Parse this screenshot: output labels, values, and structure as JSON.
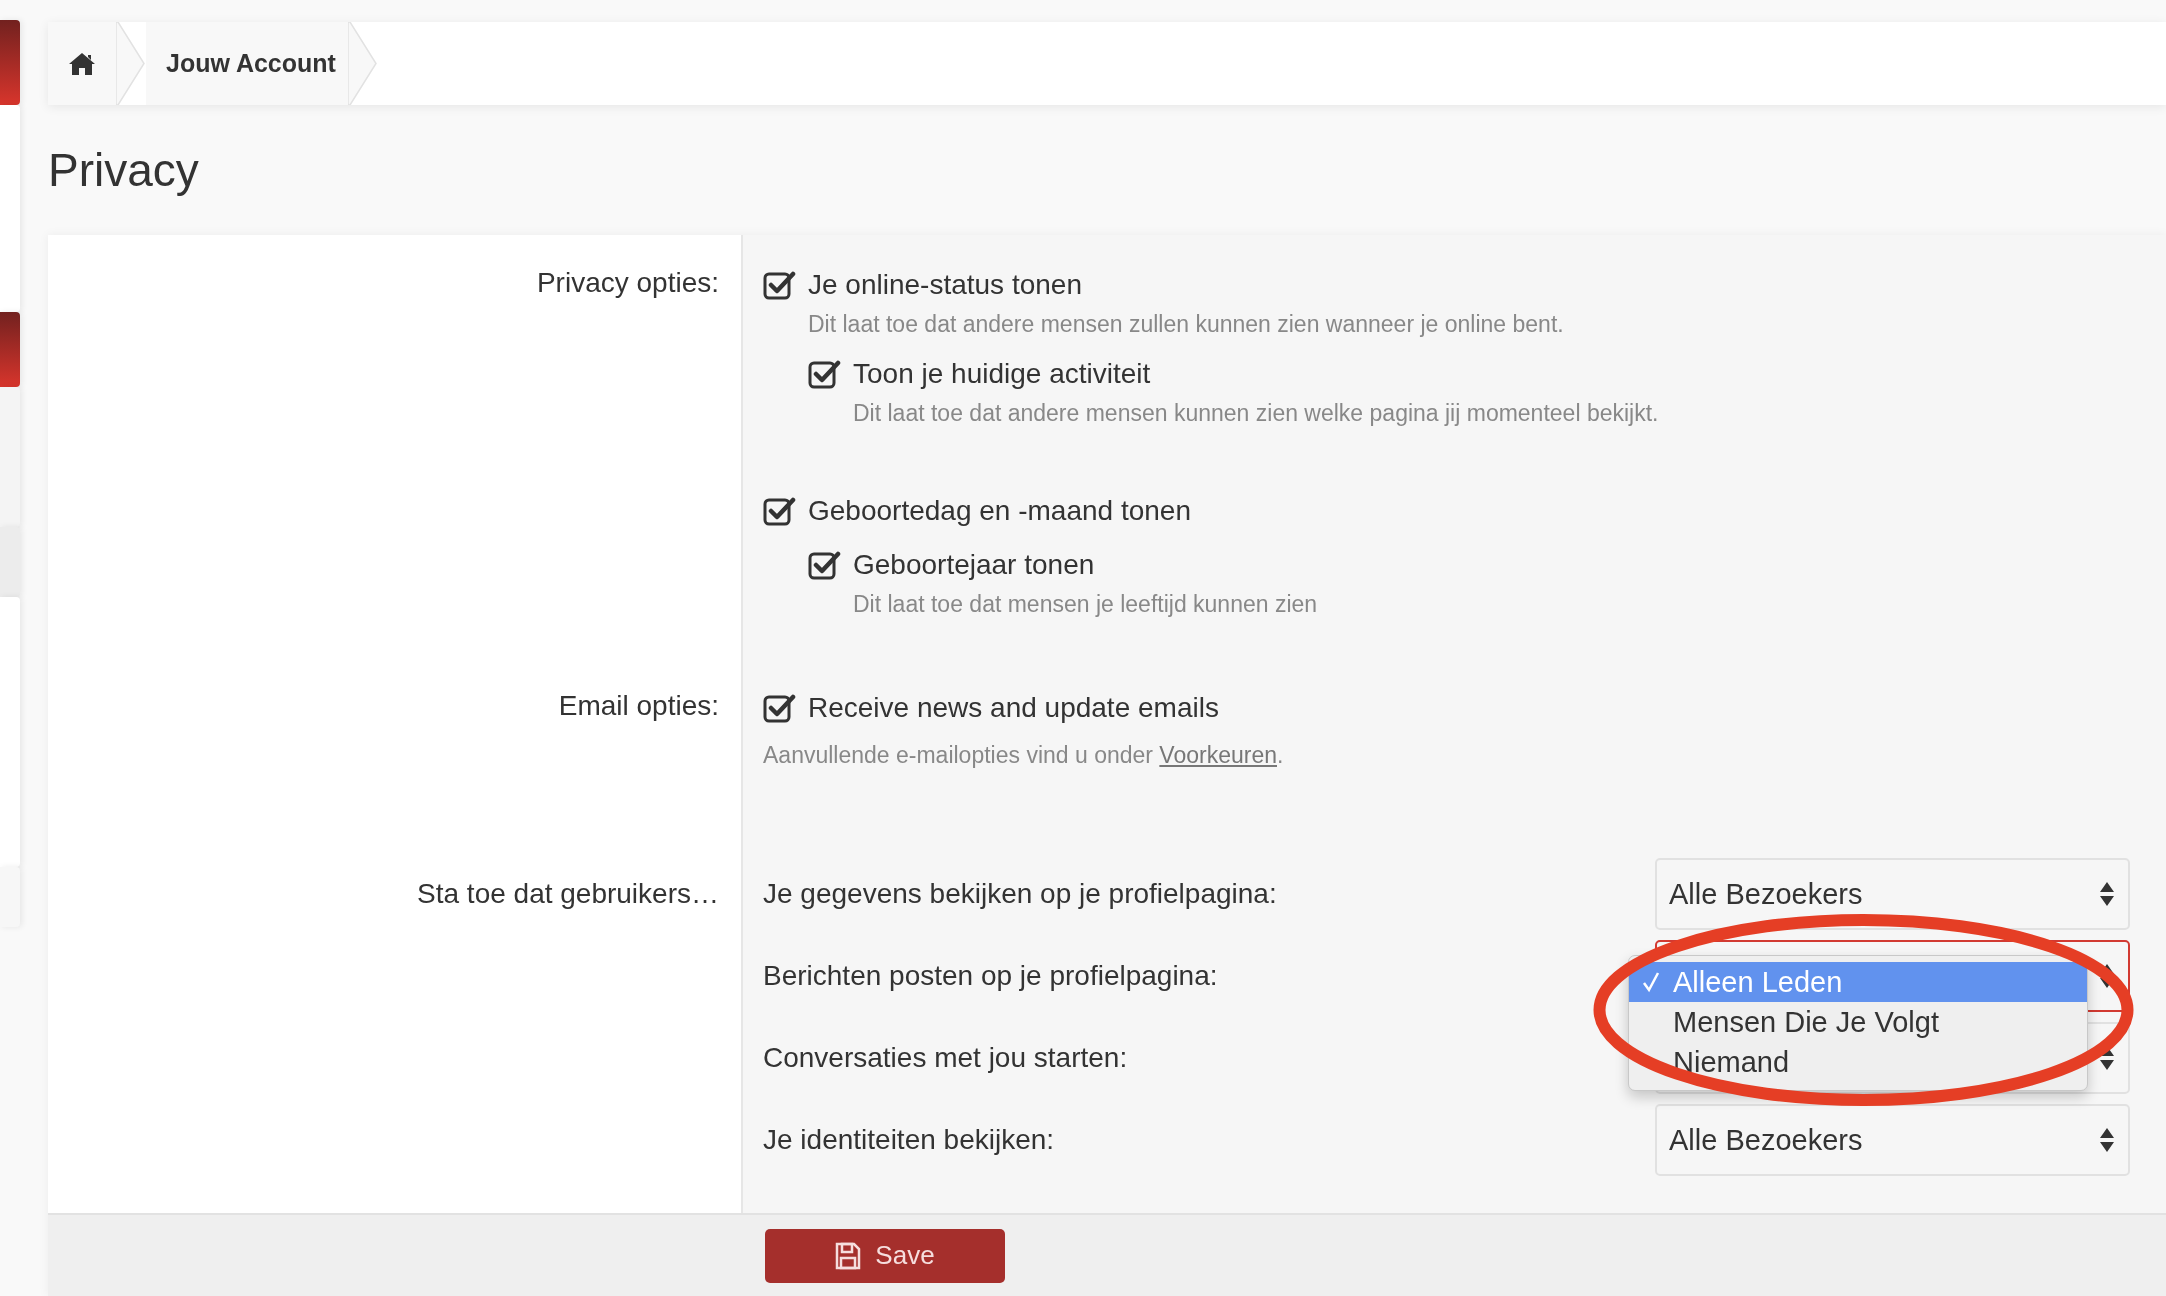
{
  "breadcrumb": [
    {
      "label": "Jouw Account"
    }
  ],
  "title": "Privacy",
  "sections": [
    {
      "label": "Privacy opties:",
      "items": [
        {
          "kind": "checkbox",
          "label": "Je online-status tonen",
          "checked": true,
          "hint": "Dit laat toe dat andere mensen zullen kunnen zien wanneer je online bent.",
          "children": [
            {
              "kind": "checkbox",
              "label": "Toon je huidige activiteit",
              "checked": true,
              "hint": "Dit laat toe dat andere mensen kunnen zien welke pagina jij momenteel bekijkt."
            }
          ]
        },
        {
          "kind": "checkbox",
          "label": "Geboortedag en -maand tonen",
          "checked": true,
          "children": [
            {
              "kind": "checkbox",
              "label": "Geboortejaar tonen",
              "checked": true,
              "hint": "Dit laat toe dat mensen je leeftijd kunnen zien"
            }
          ]
        }
      ]
    },
    {
      "label": "Email opties:",
      "items": [
        {
          "kind": "checkbox",
          "label": "Receive news and update emails",
          "checked": true
        },
        {
          "kind": "note",
          "text": "Aanvullende e-mailopties vind u onder ",
          "link": "Voorkeuren",
          "after": "."
        }
      ]
    },
    {
      "label": "Sta toe dat gebruikers…",
      "items": [
        {
          "kind": "select",
          "label": "Je gegevens bekijken op je profielpagina:",
          "value": "Alle Bezoekers",
          "focused": false
        },
        {
          "kind": "select",
          "label": "Berichten posten op je profielpagina:",
          "focused": true,
          "menu": [
            {
              "label": "Alleen Leden",
              "selected": true
            },
            {
              "label": "Mensen Die Je Volgt",
              "selected": false
            },
            {
              "label": "Niemand",
              "selected": false
            }
          ]
        },
        {
          "kind": "select",
          "label": "Conversaties met jou starten:",
          "focused": false
        },
        {
          "kind": "select",
          "label": "Je identiteiten bekijken:",
          "value": "Alle Bezoekers",
          "focused": false
        }
      ]
    }
  ],
  "save_button": "Save"
}
